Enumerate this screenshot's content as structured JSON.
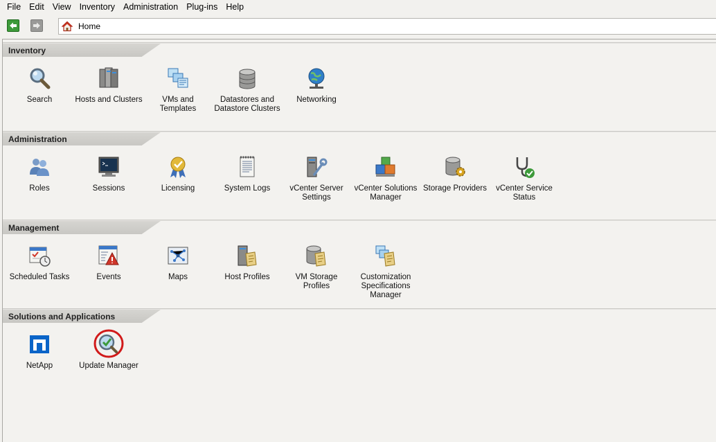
{
  "menu": [
    "File",
    "Edit",
    "View",
    "Inventory",
    "Administration",
    "Plug-ins",
    "Help"
  ],
  "nav": {
    "address": "Home"
  },
  "sections": [
    {
      "title": "Inventory",
      "items": [
        {
          "label1": "Search",
          "label2": "",
          "icon": "search-icon"
        },
        {
          "label1": "Hosts and Clusters",
          "label2": "",
          "icon": "hosts-clusters-icon"
        },
        {
          "label1": "VMs and",
          "label2": "Templates",
          "icon": "vms-templates-icon"
        },
        {
          "label1": "Datastores and",
          "label2": "Datastore Clusters",
          "icon": "datastores-icon"
        },
        {
          "label1": "Networking",
          "label2": "",
          "icon": "networking-icon"
        }
      ]
    },
    {
      "title": "Administration",
      "items": [
        {
          "label1": "Roles",
          "label2": "",
          "icon": "roles-icon"
        },
        {
          "label1": "Sessions",
          "label2": "",
          "icon": "sessions-icon"
        },
        {
          "label1": "Licensing",
          "label2": "",
          "icon": "licensing-icon"
        },
        {
          "label1": "System Logs",
          "label2": "",
          "icon": "system-logs-icon"
        },
        {
          "label1": "vCenter Server",
          "label2": "Settings",
          "icon": "server-settings-icon"
        },
        {
          "label1": "vCenter Solutions",
          "label2": "Manager",
          "icon": "solutions-manager-icon"
        },
        {
          "label1": "Storage Providers",
          "label2": "",
          "icon": "storage-providers-icon"
        },
        {
          "label1": "vCenter Service",
          "label2": "Status",
          "icon": "service-status-icon"
        }
      ]
    },
    {
      "title": "Management",
      "items": [
        {
          "label1": "Scheduled Tasks",
          "label2": "",
          "icon": "scheduled-tasks-icon"
        },
        {
          "label1": "Events",
          "label2": "",
          "icon": "events-icon"
        },
        {
          "label1": "Maps",
          "label2": "",
          "icon": "maps-icon"
        },
        {
          "label1": "Host Profiles",
          "label2": "",
          "icon": "host-profiles-icon"
        },
        {
          "label1": "VM Storage",
          "label2": "Profiles",
          "icon": "vm-storage-profiles-icon"
        },
        {
          "label1": "Customization",
          "label2": "Specifications",
          "label3": "Manager",
          "icon": "customization-icon"
        }
      ]
    },
    {
      "title": "Solutions and Applications",
      "items": [
        {
          "label1": "NetApp",
          "label2": "",
          "icon": "netapp-icon"
        },
        {
          "label1": "Update Manager",
          "label2": "",
          "icon": "update-manager-icon"
        }
      ]
    }
  ]
}
